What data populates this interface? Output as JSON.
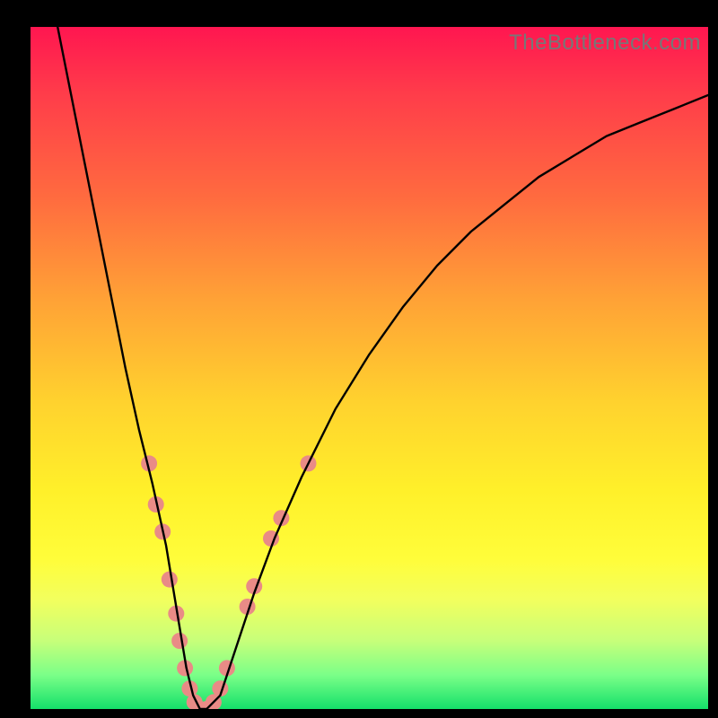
{
  "watermark": "TheBottleneck.com",
  "chart_data": {
    "type": "line",
    "title": "",
    "xlabel": "",
    "ylabel": "",
    "xlim": [
      0,
      100
    ],
    "ylim": [
      0,
      100
    ],
    "grid": false,
    "legend": false,
    "series": [
      {
        "name": "bottleneck-curve",
        "color": "#000000",
        "x": [
          4,
          6,
          8,
          10,
          12,
          14,
          16,
          18,
          20,
          22,
          23,
          24,
          25,
          26,
          28,
          30,
          33,
          36,
          40,
          45,
          50,
          55,
          60,
          65,
          70,
          75,
          80,
          85,
          90,
          95,
          100
        ],
        "y": [
          100,
          90,
          80,
          70,
          60,
          50,
          41,
          33,
          24,
          12,
          6,
          2,
          0,
          0,
          2,
          8,
          17,
          25,
          34,
          44,
          52,
          59,
          65,
          70,
          74,
          78,
          81,
          84,
          86,
          88,
          90
        ]
      }
    ],
    "markers": {
      "name": "highlight-dots",
      "color": "#e98b86",
      "radius_px": 9,
      "points": [
        {
          "x": 17.5,
          "y": 36
        },
        {
          "x": 18.5,
          "y": 30
        },
        {
          "x": 19.5,
          "y": 26
        },
        {
          "x": 20.5,
          "y": 19
        },
        {
          "x": 21.5,
          "y": 14
        },
        {
          "x": 22.0,
          "y": 10
        },
        {
          "x": 22.8,
          "y": 6
        },
        {
          "x": 23.5,
          "y": 3
        },
        {
          "x": 24.2,
          "y": 1
        },
        {
          "x": 25.0,
          "y": 0
        },
        {
          "x": 26.0,
          "y": 0
        },
        {
          "x": 27.0,
          "y": 1
        },
        {
          "x": 28.0,
          "y": 3
        },
        {
          "x": 29.0,
          "y": 6
        },
        {
          "x": 32.0,
          "y": 15
        },
        {
          "x": 33.0,
          "y": 18
        },
        {
          "x": 35.5,
          "y": 25
        },
        {
          "x": 37.0,
          "y": 28
        },
        {
          "x": 41.0,
          "y": 36
        }
      ]
    },
    "background_gradient": {
      "top": "#ff1650",
      "mid": "#fff02a",
      "bottom": "#14e06a"
    }
  }
}
